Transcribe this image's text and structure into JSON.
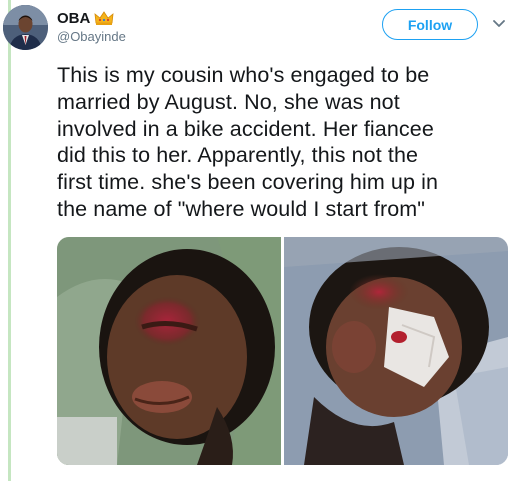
{
  "user": {
    "display_name": "OBA",
    "handle": "@Obayinde",
    "badge_icon": "crown-icon",
    "avatar_icon": "avatar-photo"
  },
  "actions": {
    "follow_label": "Follow",
    "menu_icon": "chevron-down-icon"
  },
  "tweet": {
    "lines": [
      "This is my cousin who's engaged to be",
      "married by August. No, she was not",
      "involved in a bike accident. Her fiancee",
      "did this to her. Apparently, this not the",
      "first time. she's been covering him up in",
      "the name of \"where would I start from\""
    ]
  },
  "media": {
    "photos": [
      "photo-injured-face-1",
      "photo-injured-face-2"
    ]
  },
  "colors": {
    "accent": "#1da1f2",
    "thread_line": "#c5e6c1",
    "secondary_text": "#657786"
  }
}
